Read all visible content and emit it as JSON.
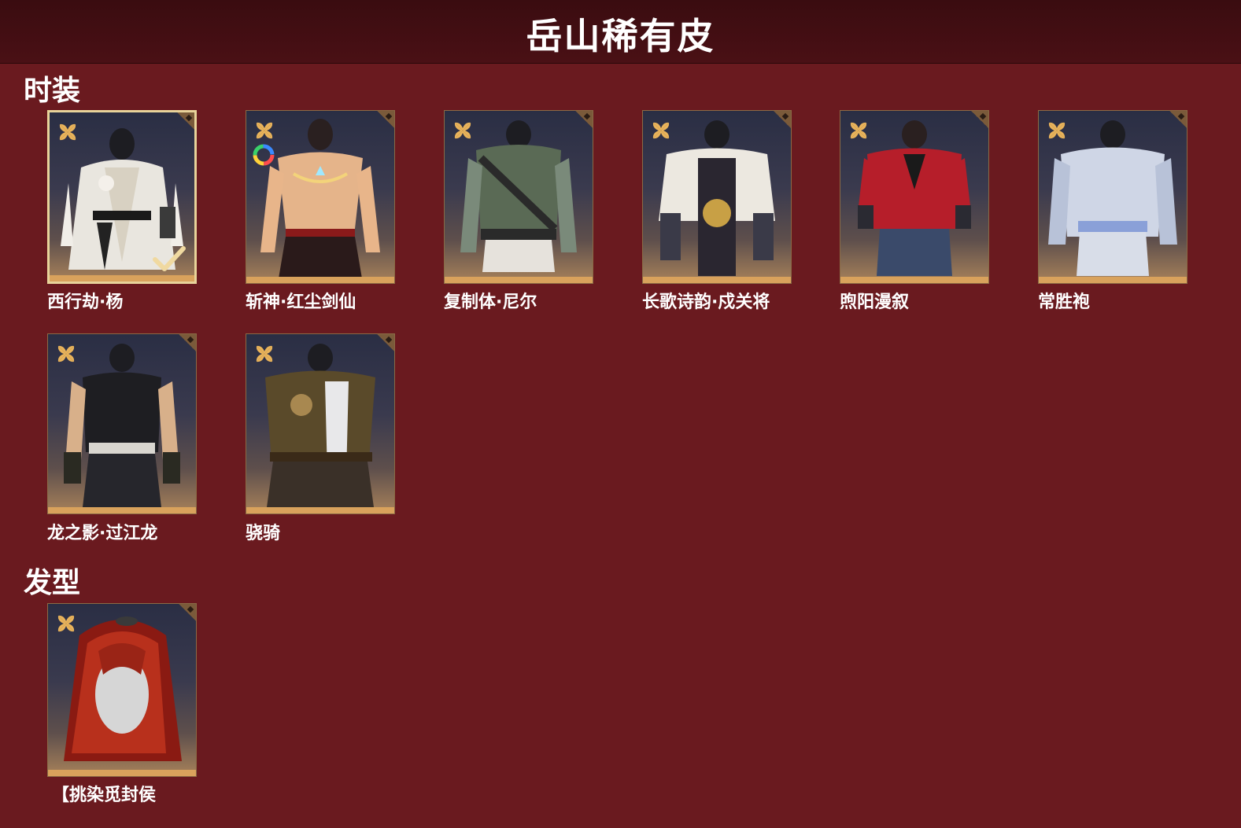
{
  "header": {
    "title": "岳山稀有皮"
  },
  "sections": {
    "outfits": {
      "label": "时装",
      "items": [
        {
          "name": "西行劫·杨",
          "selected": true,
          "color_variant": false
        },
        {
          "name": "斩神·红尘剑仙",
          "selected": false,
          "color_variant": true
        },
        {
          "name": "复制体·尼尔",
          "selected": false,
          "color_variant": false
        },
        {
          "name": "长歌诗韵·戍关将",
          "selected": false,
          "color_variant": false
        },
        {
          "name": "煦阳漫叙",
          "selected": false,
          "color_variant": false
        },
        {
          "name": "常胜袍",
          "selected": false,
          "color_variant": false
        },
        {
          "name": "龙之影·过江龙",
          "selected": false,
          "color_variant": false
        },
        {
          "name": "骁骑",
          "selected": false,
          "color_variant": false
        }
      ]
    },
    "hairstyles": {
      "label": "发型",
      "items": [
        {
          "name": "【挑染觅封侯",
          "selected": false,
          "color_variant": false
        }
      ]
    }
  },
  "icons": {
    "rarity": "four-petal-flower-icon",
    "selected_mark": "check-icon",
    "color_variant": "color-ring-icon",
    "corner": "corner-tab-icon"
  },
  "colors": {
    "background": "#6a1a1f",
    "title_bar": "#3a0c10",
    "card_bottom": "#d9a25c",
    "selected_border": "#e8d39a",
    "rarity_gold": "#e9b35a"
  }
}
